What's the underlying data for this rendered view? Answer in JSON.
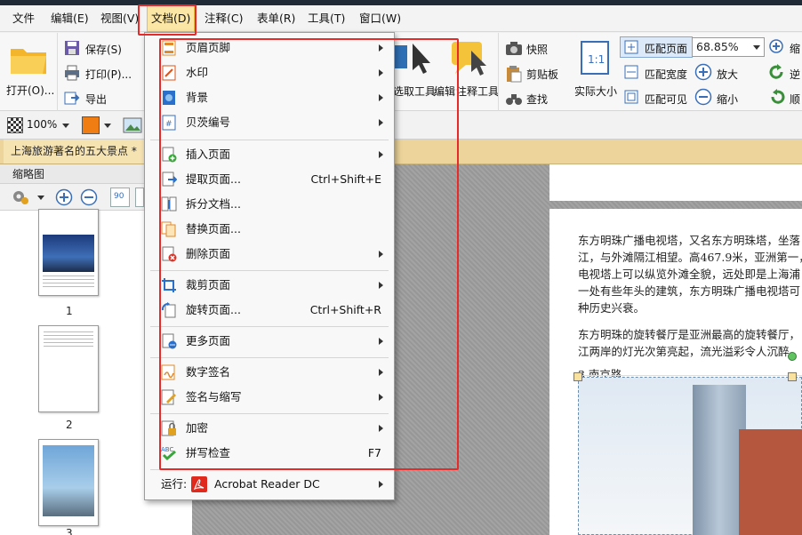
{
  "menubar": {
    "file": "文件",
    "edit": "编辑(E)",
    "view": "视图(V)",
    "document": "文档(D)",
    "comment": "注释(C)",
    "form": "表单(R)",
    "tools": "工具(T)",
    "window": "窗口(W)"
  },
  "ribbon": {
    "open": "打开(O)...",
    "save": "保存(S)",
    "print": "打印(P)...",
    "export": "导出",
    "select_tool": "选取工具",
    "edit": "编辑",
    "annotate_tool": "注释工具",
    "snapshot": "快照",
    "clipboard": "剪贴板",
    "find": "查找",
    "actual_size": "实际大小",
    "fit_page": "匹配页面",
    "fit_width": "匹配宽度",
    "fit_visible": "匹配可见",
    "zoom_value": "68.85%",
    "zoom_in": "放大",
    "zoom_out": "缩小",
    "rotate_ccw": "逆",
    "rotate_cw": "顺",
    "zoom_partial": "缩"
  },
  "row2": {
    "zoom_percent": "100%"
  },
  "doc_tab": {
    "title": "上海旅游著名的五大景点 *"
  },
  "sidebar": {
    "title": "缩略图",
    "rotate_label": "90",
    "pages": [
      "1",
      "2",
      "3"
    ]
  },
  "document_text": {
    "line1": "东方明珠广播电视塔，又名东方明珠塔，坐落",
    "line2": "江，与外滩隔江相望。高467.9米，亚洲第一，",
    "line3": "电视塔上可以纵览外滩全貌，远处即是上海浦",
    "line4": "一处有些年头的建筑，东方明珠广播电视塔可",
    "line5": "种历史兴衰。",
    "line6": "东方明珠的旋转餐厅是亚洲最高的旋转餐厅，",
    "line7": "江两岸的灯光次第亮起，流光溢彩令人沉醉。",
    "heading": "3.南京路"
  },
  "document_menu": {
    "items": [
      {
        "label": "页眉页脚",
        "shortcut": ""
      },
      {
        "label": "水印",
        "shortcut": ""
      },
      {
        "label": "背景",
        "shortcut": ""
      },
      {
        "label": "贝茨编号",
        "shortcut": ""
      },
      {
        "label": "插入页面",
        "shortcut": ""
      },
      {
        "label": "提取页面...",
        "shortcut": "Ctrl+Shift+E"
      },
      {
        "label": "拆分文档...",
        "shortcut": ""
      },
      {
        "label": "替换页面...",
        "shortcut": ""
      },
      {
        "label": "删除页面",
        "shortcut": ""
      },
      {
        "label": "裁剪页面",
        "shortcut": ""
      },
      {
        "label": "旋转页面...",
        "shortcut": "Ctrl+Shift+R"
      },
      {
        "label": "更多页面",
        "shortcut": ""
      },
      {
        "label": "数字签名",
        "shortcut": ""
      },
      {
        "label": "签名与缩写",
        "shortcut": ""
      },
      {
        "label": "加密",
        "shortcut": ""
      },
      {
        "label": "拼写检查",
        "shortcut": "F7"
      }
    ],
    "run_label": "运行:",
    "run_app": "Acrobat Reader DC",
    "spell_icon_text": "ABC"
  },
  "colors": {
    "highlight_border": "#e62a2a",
    "active_menu_bg": "#fbe6a6",
    "doc_tab_bg": "#ecd49a"
  }
}
